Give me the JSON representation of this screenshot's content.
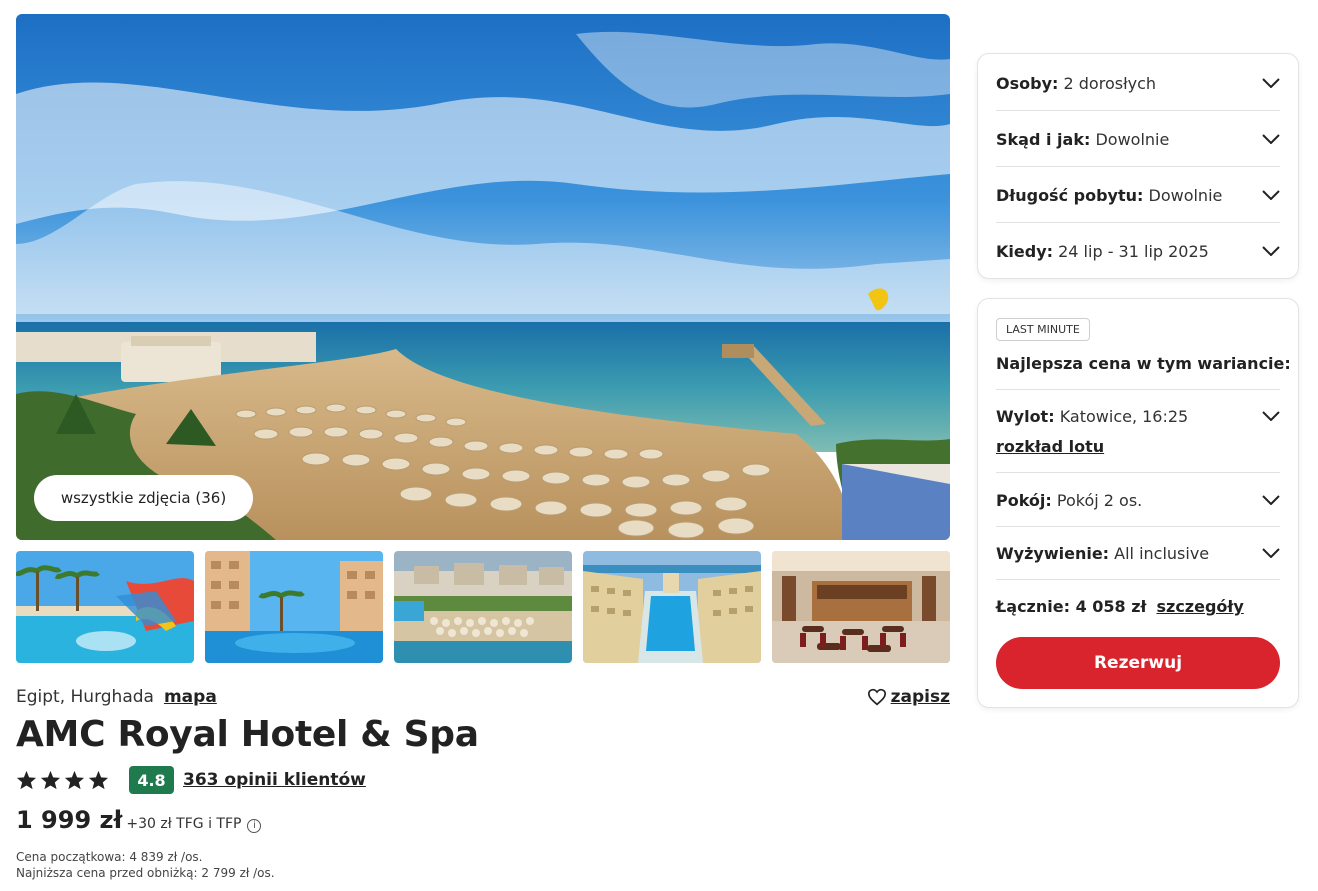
{
  "gallery": {
    "all_photos_label": "wszystkie zdjęcia (36)",
    "thumbnails": [
      "pool-slides-photo",
      "hotel-pool-courtyard-photo",
      "aerial-beach-photo",
      "pool-between-buildings-photo",
      "restaurant-bar-photo"
    ]
  },
  "hotel": {
    "location": "Egipt, Hurghada",
    "map_link": "mapa",
    "save_label": "zapisz",
    "name": "AMC Royal Hotel & Spa",
    "stars": 4,
    "score": "4.8",
    "reviews": "363 opinii klientów",
    "price": "1 999 zł",
    "price_extra": "+30 zł TFG i TFP",
    "info_icon": "i",
    "initial_price": "Cena początkowa: 4 839 zł /os.",
    "lowest_price": "Najniższa cena przed obniżką: 2 799 zł /os."
  },
  "filters": [
    {
      "label": "Osoby:",
      "value": "2 dorosłych"
    },
    {
      "label": "Skąd i jak:",
      "value": "Dowolnie"
    },
    {
      "label": "Długość pobytu:",
      "value": "Dowolnie"
    },
    {
      "label": "Kiedy:",
      "value": "24 lip - 31 lip 2025"
    }
  ],
  "offer": {
    "badge": "LAST MINUTE",
    "heading": "Najlepsza cena w tym wariancie:",
    "flight_label": "Wylot:",
    "flight_value": "Katowice, 16:25",
    "flight_link": "rozkład lotu",
    "room_label": "Pokój:",
    "room_value": "Pokój 2 os.",
    "board_label": "Wyżywienie:",
    "board_value": "All inclusive",
    "total_label": "Łącznie: 4 058 zł",
    "details_link": "szczegóły",
    "book_label": "Rezerwuj"
  },
  "colors": {
    "accent_red": "#d9232d",
    "score_green": "#1f7a4d"
  }
}
